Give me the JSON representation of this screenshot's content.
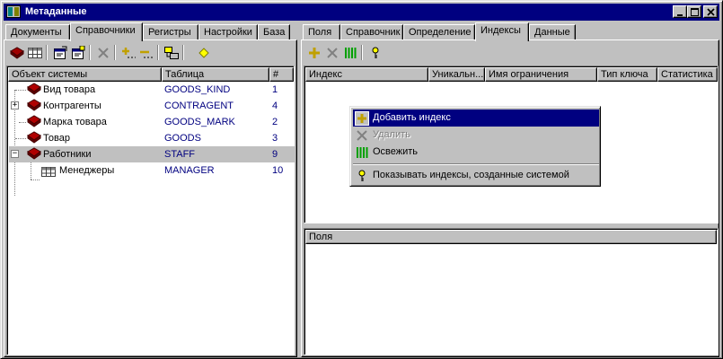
{
  "window": {
    "title": "Метаданные"
  },
  "left": {
    "tabs": [
      {
        "label": "Документы",
        "active": false
      },
      {
        "label": "Справочники",
        "active": true
      },
      {
        "label": "Регистры",
        "active": false
      },
      {
        "label": "Настройки",
        "active": false
      },
      {
        "label": "База",
        "active": false
      }
    ],
    "columns": [
      "Объект системы",
      "Таблица",
      "#"
    ],
    "rows": [
      {
        "name": "Вид товара",
        "table": "GOODS_KIND",
        "num": "1"
      },
      {
        "name": "Контрагенты",
        "table": "CONTRAGENT",
        "num": "4"
      },
      {
        "name": "Марка товара",
        "table": "GOODS_MARK",
        "num": "2"
      },
      {
        "name": "Товар",
        "table": "GOODS",
        "num": "3"
      },
      {
        "name": "Работники",
        "table": "STAFF",
        "num": "9"
      },
      {
        "name": "Менеджеры",
        "table": "MANAGER",
        "num": "10"
      }
    ]
  },
  "right": {
    "tabs": [
      {
        "label": "Поля",
        "active": false
      },
      {
        "label": "Справочник",
        "active": false
      },
      {
        "label": "Определение",
        "active": false
      },
      {
        "label": "Индексы",
        "active": true
      },
      {
        "label": "Данные",
        "active": false
      }
    ],
    "index_columns": [
      "Индекс",
      "Уникальн...",
      "Имя ограничения",
      "Тип ключа",
      "Статистика"
    ],
    "fields_header": "Поля"
  },
  "context_menu": {
    "items": [
      {
        "label": "Добавить индекс",
        "state": "highlighted"
      },
      {
        "label": "Удалить",
        "state": "disabled"
      },
      {
        "label": "Освежить",
        "state": "normal"
      },
      {
        "label": "Показывать индексы, созданные системой",
        "state": "normal"
      }
    ]
  },
  "colors": {
    "titlebar": "#000080",
    "face": "#c0c0c0",
    "table_text": "#000080"
  }
}
